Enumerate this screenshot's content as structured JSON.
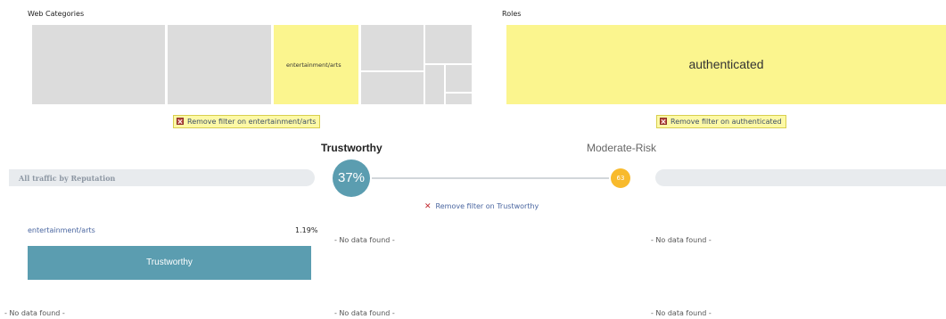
{
  "web_categories": {
    "title": "Web Categories",
    "selected_label": "entertainment/arts",
    "remove_filter": "Remove filter on entertainment/arts"
  },
  "roles": {
    "title": "Roles",
    "selected_label": "authenticated",
    "remove_filter": "Remove filter on authenticated"
  },
  "reputation": {
    "band_label": "All traffic by Reputation",
    "trustworthy_label": "Trustworthy",
    "trustworthy_value": "37%",
    "moderate_label": "Moderate-Risk",
    "moderate_value": "63",
    "remove_filter": "Remove filter on Trustworthy"
  },
  "results": {
    "top_category_label": "entertainment/arts",
    "top_category_percent": "1.19%",
    "bar_label": "Trustworthy",
    "bar_fill_fraction": 1.0,
    "no_data": "- No data found -"
  },
  "colors": {
    "treemap_default": "#dcdcdc",
    "treemap_selected": "#fbf58e",
    "trustworthy": "#5b9db0",
    "moderate_risk": "#f8ba2c",
    "filter_chip_bg": "#fdf9a6"
  }
}
